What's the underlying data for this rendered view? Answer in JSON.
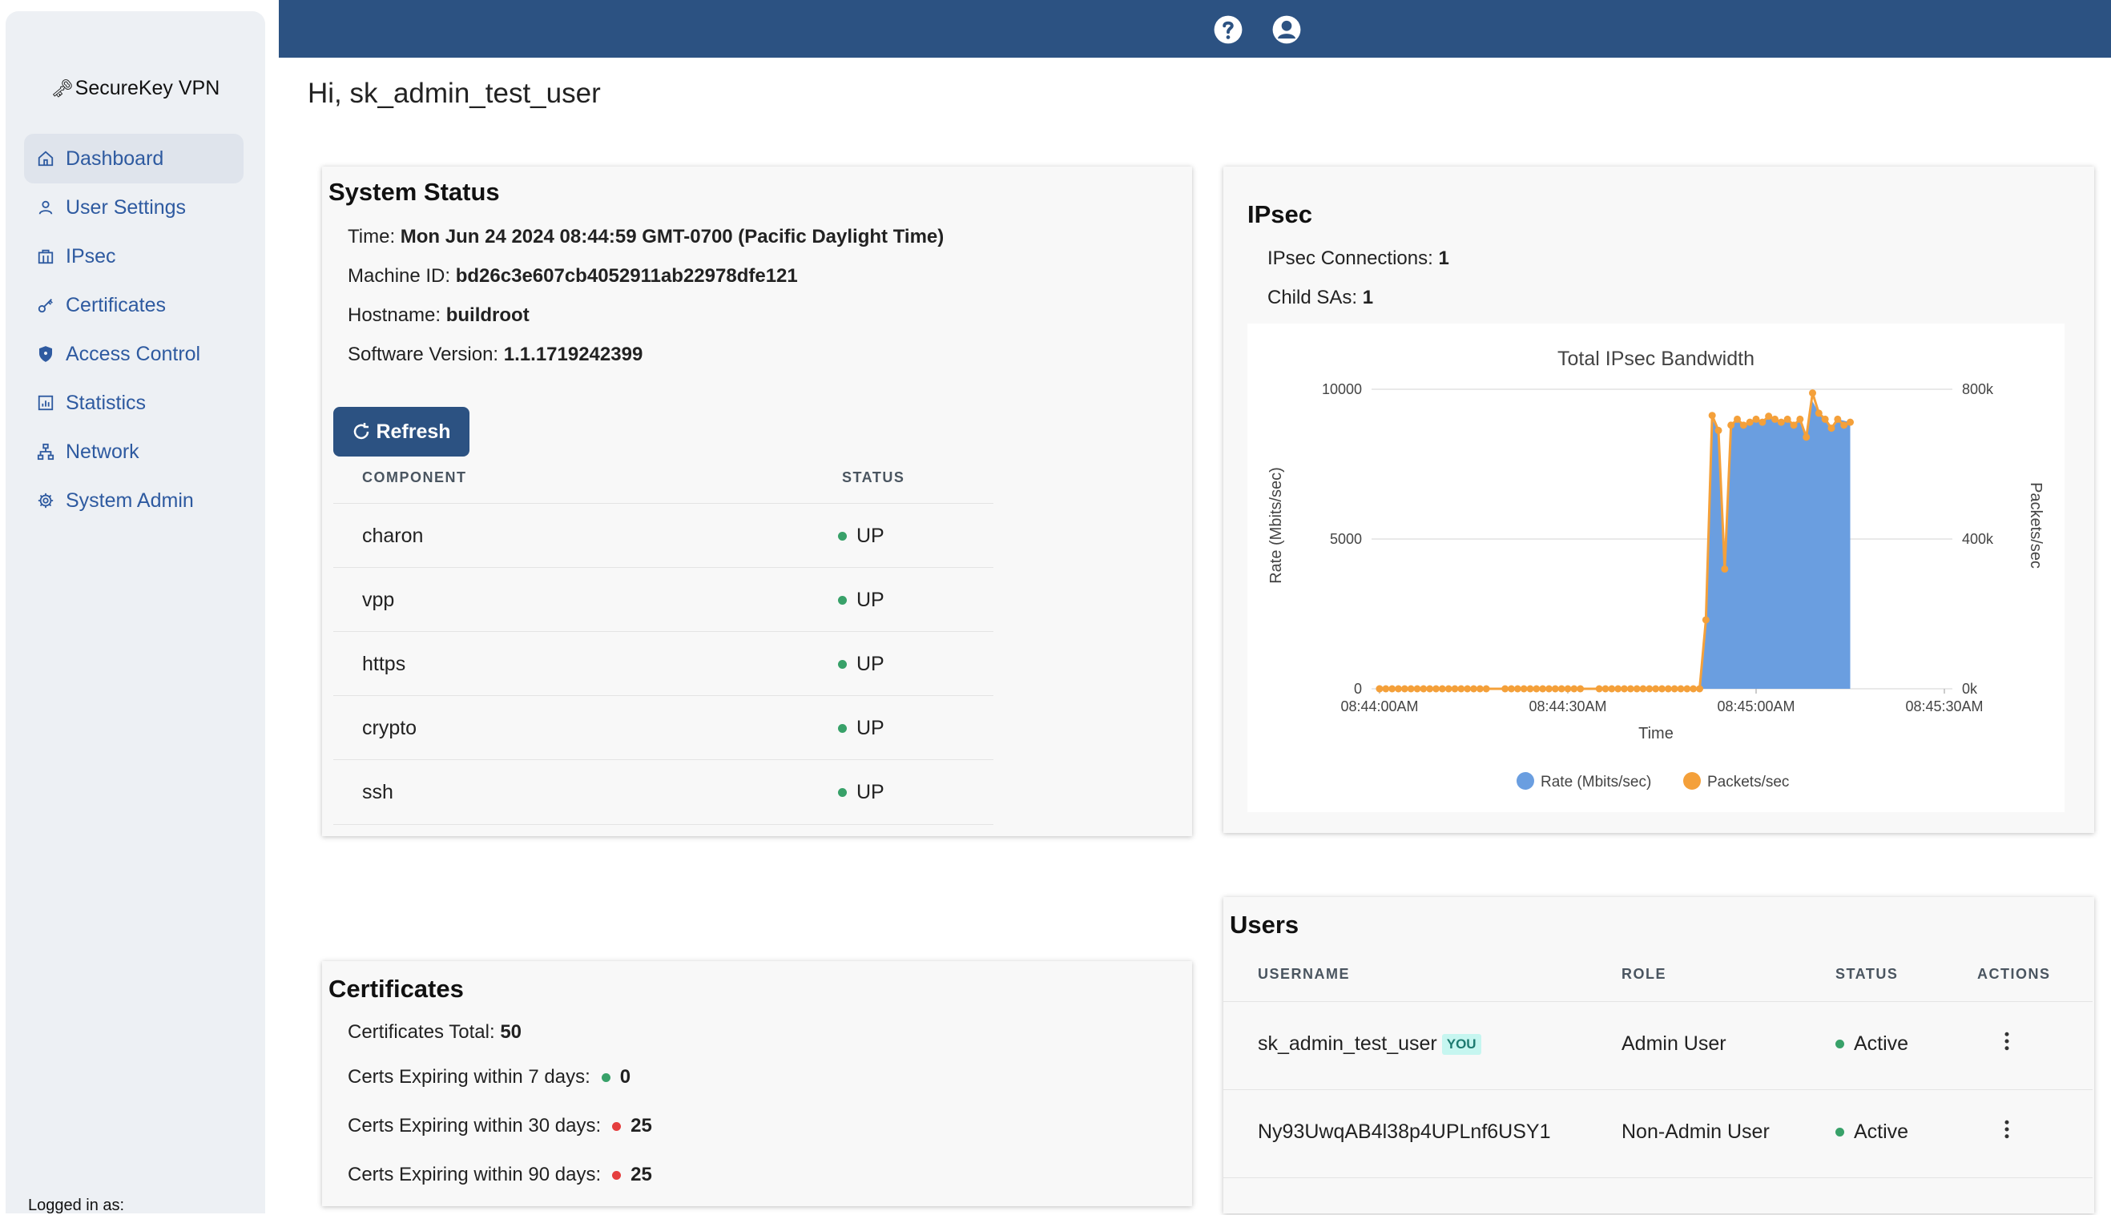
{
  "app": {
    "name": "SecureKey VPN",
    "greeting": "Hi, sk_admin_test_user",
    "logged_in_label": "Logged in as:"
  },
  "sidebar": {
    "items": [
      {
        "label": "Dashboard",
        "icon": "home-icon"
      },
      {
        "label": "User Settings",
        "icon": "user-icon"
      },
      {
        "label": "IPsec",
        "icon": "ipsec-icon"
      },
      {
        "label": "Certificates",
        "icon": "key-icon"
      },
      {
        "label": "Access Control",
        "icon": "shield-icon"
      },
      {
        "label": "Statistics",
        "icon": "chart-icon"
      },
      {
        "label": "Network",
        "icon": "network-icon"
      },
      {
        "label": "System Admin",
        "icon": "gear-icon"
      }
    ]
  },
  "topbar": {
    "icons": [
      "help-icon",
      "account-icon"
    ],
    "color": "#2c5282"
  },
  "system_status": {
    "title": "System Status",
    "time_label": "Time:",
    "time_value": "Mon Jun 24 2024 08:44:59 GMT-0700 (Pacific Daylight Time)",
    "machine_label": "Machine ID:",
    "machine_value": "bd26c3e607cb4052911ab22978dfe121",
    "host_label": "Hostname:",
    "host_value": "buildroot",
    "version_label": "Software Version:",
    "version_value": "1.1.1719242399",
    "refresh_label": "Refresh",
    "col_component": "COMPONENT",
    "col_status": "STATUS",
    "components": [
      {
        "name": "charon",
        "status": "UP"
      },
      {
        "name": "vpp",
        "status": "UP"
      },
      {
        "name": "https",
        "status": "UP"
      },
      {
        "name": "crypto",
        "status": "UP"
      },
      {
        "name": "ssh",
        "status": "UP"
      }
    ]
  },
  "ipsec": {
    "title": "IPsec",
    "connections_label": "IPsec Connections:",
    "connections_value": "1",
    "child_label": "Child SAs:",
    "child_value": "1"
  },
  "chart_data": {
    "type": "area",
    "title": "Total IPsec Bandwidth",
    "xlabel": "Time",
    "ylabel": "Rate (Mbits/sec)",
    "y2label": "Packets/sec",
    "ylim": [
      0,
      10000
    ],
    "y2lim": [
      0,
      800000
    ],
    "yticks": [
      "0",
      "5000",
      "10000"
    ],
    "y2ticks": [
      "0k",
      "400k",
      "800k"
    ],
    "xticks": [
      "08:44:00AM",
      "08:44:30AM",
      "08:45:00AM",
      "08:45:30AM"
    ],
    "xlim_seconds": [
      0,
      90
    ],
    "legend_position": "bottom",
    "series": [
      {
        "name": "Rate (Mbits/sec)",
        "color": "#6a9ee0",
        "axis": "left",
        "x": [
          0,
          51,
          52,
          53,
          54,
          55,
          56,
          57,
          58,
          59,
          60,
          61,
          62,
          63,
          64,
          65,
          66,
          67,
          68,
          69,
          70,
          71,
          72,
          73,
          75,
          75
        ],
        "values": [
          0,
          0,
          2300,
          9000,
          8600,
          4000,
          8800,
          9000,
          8800,
          8900,
          9000,
          8900,
          9100,
          9000,
          8900,
          9000,
          8800,
          9000,
          8400,
          9600,
          9200,
          9000,
          8700,
          9000,
          8900,
          0
        ]
      },
      {
        "name": "Packets/sec",
        "color": "#f4a03a",
        "axis": "right",
        "x": [
          0,
          51,
          52,
          53,
          54,
          55,
          56,
          57,
          58,
          59,
          60,
          61,
          62,
          63,
          64,
          65,
          66,
          67,
          68,
          69,
          70,
          71,
          72,
          73,
          74,
          75
        ],
        "values": [
          0,
          0,
          184000,
          730000,
          690000,
          320000,
          704000,
          720000,
          704000,
          712000,
          720000,
          712000,
          728000,
          720000,
          712000,
          720000,
          704000,
          720000,
          672000,
          790000,
          736000,
          720000,
          696000,
          720000,
          704000,
          712000
        ]
      }
    ]
  },
  "certificates": {
    "title": "Certificates",
    "total_label": "Certificates Total:",
    "total_value": "50",
    "exp7_label": "Certs Expiring within 7 days:",
    "exp7_value": "0",
    "exp30_label": "Certs Expiring within 30 days:",
    "exp30_value": "25",
    "exp90_label": "Certs Expiring within 90 days:",
    "exp90_value": "25"
  },
  "users": {
    "title": "Users",
    "col_username": "USERNAME",
    "col_role": "ROLE",
    "col_status": "STATUS",
    "col_actions": "ACTIONS",
    "you_badge": "YOU",
    "rows": [
      {
        "username": "sk_admin_test_user",
        "role": "Admin User",
        "status": "Active"
      },
      {
        "username": "Ny93UwqAB4l38p4UPLnf6USY1",
        "role": "Non-Admin User",
        "status": "Active"
      }
    ]
  }
}
